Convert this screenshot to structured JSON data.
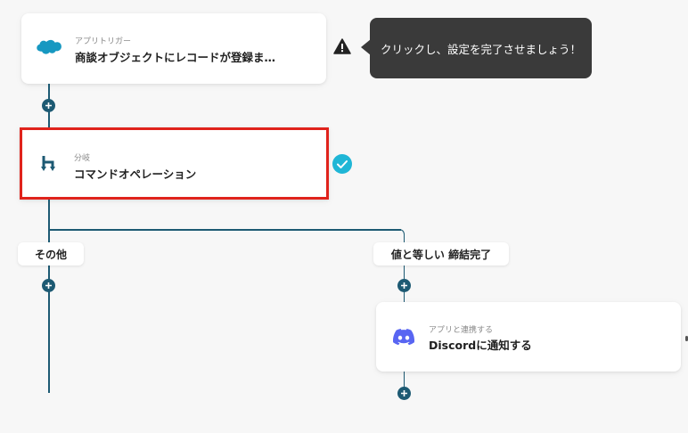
{
  "trigger": {
    "subtitle": "アプリトリガー",
    "title": "商談オブジェクトにレコードが登録ま…",
    "icon": "salesforce-cloud-icon",
    "color": "#1798c1"
  },
  "warning": {
    "icon": "warning-icon"
  },
  "tooltip": {
    "text": "クリックし、設定を完了させましょう！"
  },
  "branch_step": {
    "subtitle": "分岐",
    "title": "コマンドオペレーション",
    "icon": "branch-icon",
    "highlight_color": "#e0231c",
    "status_icon": "check-circle-icon",
    "status_color": "#1fb6d6"
  },
  "branches": [
    {
      "label": "その他"
    },
    {
      "label": "値と等しい 締結完了"
    }
  ],
  "discord_step": {
    "subtitle": "アプリと連携する",
    "title": "Discordに通知する",
    "icon": "discord-icon",
    "color": "#5865f2"
  },
  "colors": {
    "connector": "#1d5a73",
    "tooltip_bg": "#3a3a3a"
  }
}
